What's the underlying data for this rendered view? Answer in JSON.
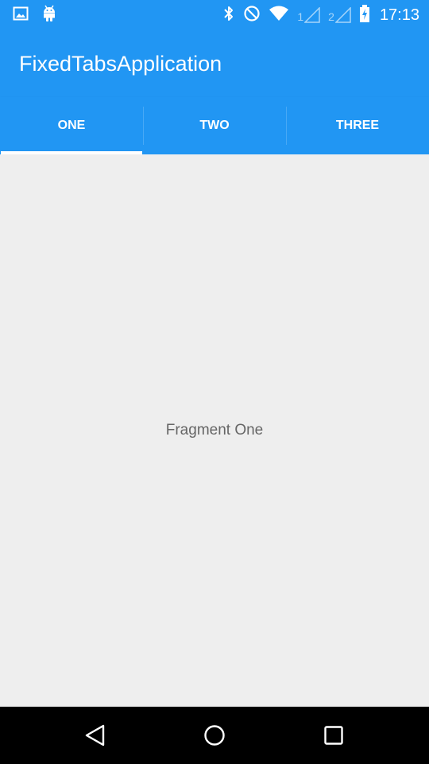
{
  "status_bar": {
    "time": "17:13",
    "sim1_label": "1",
    "sim2_label": "2",
    "icons": [
      "gallery-icon",
      "android-icon",
      "bluetooth-icon",
      "do-not-disturb-icon",
      "wifi-icon",
      "signal-icon",
      "battery-charging-icon"
    ],
    "background_color": "#2196f3"
  },
  "app_bar": {
    "title": "FixedTabsApplication",
    "background_color": "#2196f3"
  },
  "tabs": [
    {
      "label": "ONE",
      "selected": true
    },
    {
      "label": "TWO",
      "selected": false
    },
    {
      "label": "THREE",
      "selected": false
    }
  ],
  "content": {
    "text": "Fragment One",
    "background_color": "#eeeeee"
  },
  "nav_bar": {
    "icons": [
      "back-icon",
      "home-icon",
      "recents-icon"
    ]
  }
}
